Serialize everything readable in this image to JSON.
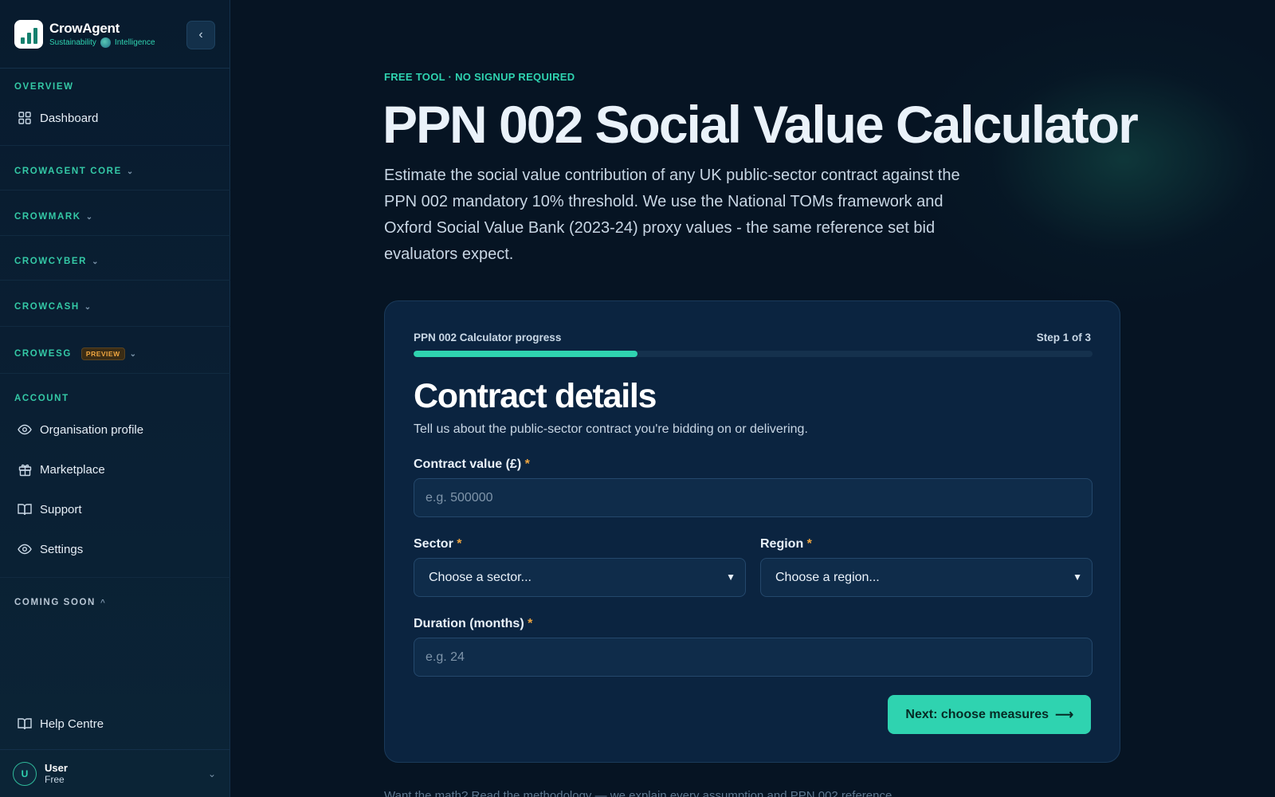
{
  "brand": {
    "name": "CrowAgent",
    "tag_left": "Sustainability",
    "tag_right": "Intelligence"
  },
  "sidebar": {
    "sections": {
      "overview": "OVERVIEW",
      "core": "CROWAGENT CORE",
      "mark": "CROWMARK",
      "cyber": "CROWCYBER",
      "cash": "CROWCASH",
      "esg": "CROWESG",
      "esg_badge": "PREVIEW",
      "account": "ACCOUNT",
      "coming_soon": "COMING SOON"
    },
    "items": {
      "dashboard": "Dashboard",
      "org_profile": "Organisation profile",
      "marketplace": "Marketplace",
      "support": "Support",
      "settings": "Settings",
      "help": "Help Centre"
    },
    "user": {
      "initial": "U",
      "name": "User",
      "plan": "Free"
    }
  },
  "main": {
    "eyebrow": "FREE TOOL · NO SIGNUP REQUIRED",
    "title": "PPN 002 Social Value Calculator",
    "intro": "Estimate the social value contribution of any UK public-sector contract against the PPN 002 mandatory 10% threshold. We use the National TOMs framework and Oxford Social Value Bank (2023-24) proxy values - the same reference set bid evaluators expect.",
    "footer_hint": "Want the math? Read the methodology — we explain every assumption and PPN 002 reference."
  },
  "card": {
    "progress_label": "PPN 002 Calculator progress",
    "progress_step": "Step 1 of 3",
    "progress_fraction": 0.33,
    "title": "Contract details",
    "subtitle": "Tell us about the public-sector contract you're bidding on or delivering.",
    "fields": {
      "contract_value_label": "Contract value (£)",
      "contract_value_placeholder": "e.g. 500000",
      "sector_label": "Sector",
      "sector_value": "Choose a sector...",
      "region_label": "Region",
      "region_value": "Choose a region...",
      "duration_label": "Duration (months)",
      "duration_placeholder": "e.g. 24",
      "required_mark": "*"
    },
    "next_label": "Next: choose measures",
    "next_arrow": "⟶"
  },
  "colors": {
    "accent": "#2fd3b0",
    "required": "#f0a640",
    "background": "#061423",
    "card": "#0b2440"
  }
}
